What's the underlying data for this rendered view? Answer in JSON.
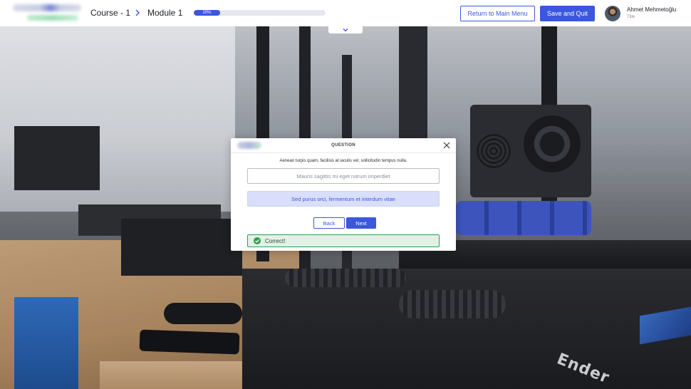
{
  "header": {
    "breadcrumb": {
      "course": "Course - 1",
      "module": "Module 1"
    },
    "progress": {
      "label": "20%",
      "fraction": 0.2
    },
    "return_label": "Return to Main Menu",
    "save_label": "Save and Quit",
    "user": {
      "name": "Ahmet Mehmetoğlu",
      "title": "Title"
    }
  },
  "scene": {
    "brand_text": "Ender"
  },
  "modal": {
    "title": "QUESTION",
    "question": "Aenean turpis quam, facilisis at iaculis vel, sollicitudin tempus nulla.",
    "answers": [
      {
        "label": "Mauris sagittis mi eget rutrum imperdiet",
        "selected": false
      },
      {
        "label": "Sed purus orci, fermentum et interdum vitae",
        "selected": true
      }
    ],
    "back_label": "Back",
    "next_label": "Next",
    "result": {
      "text": "Correct!",
      "status": "success"
    }
  },
  "colors": {
    "accent": "#3b57e0",
    "success_border": "#2e9e52",
    "success_bg": "#dff3e4",
    "selected_answer_bg": "#d9defa"
  },
  "icons": [
    "chevron-right-icon",
    "chevron-down-icon",
    "close-icon",
    "check-circle-icon"
  ]
}
